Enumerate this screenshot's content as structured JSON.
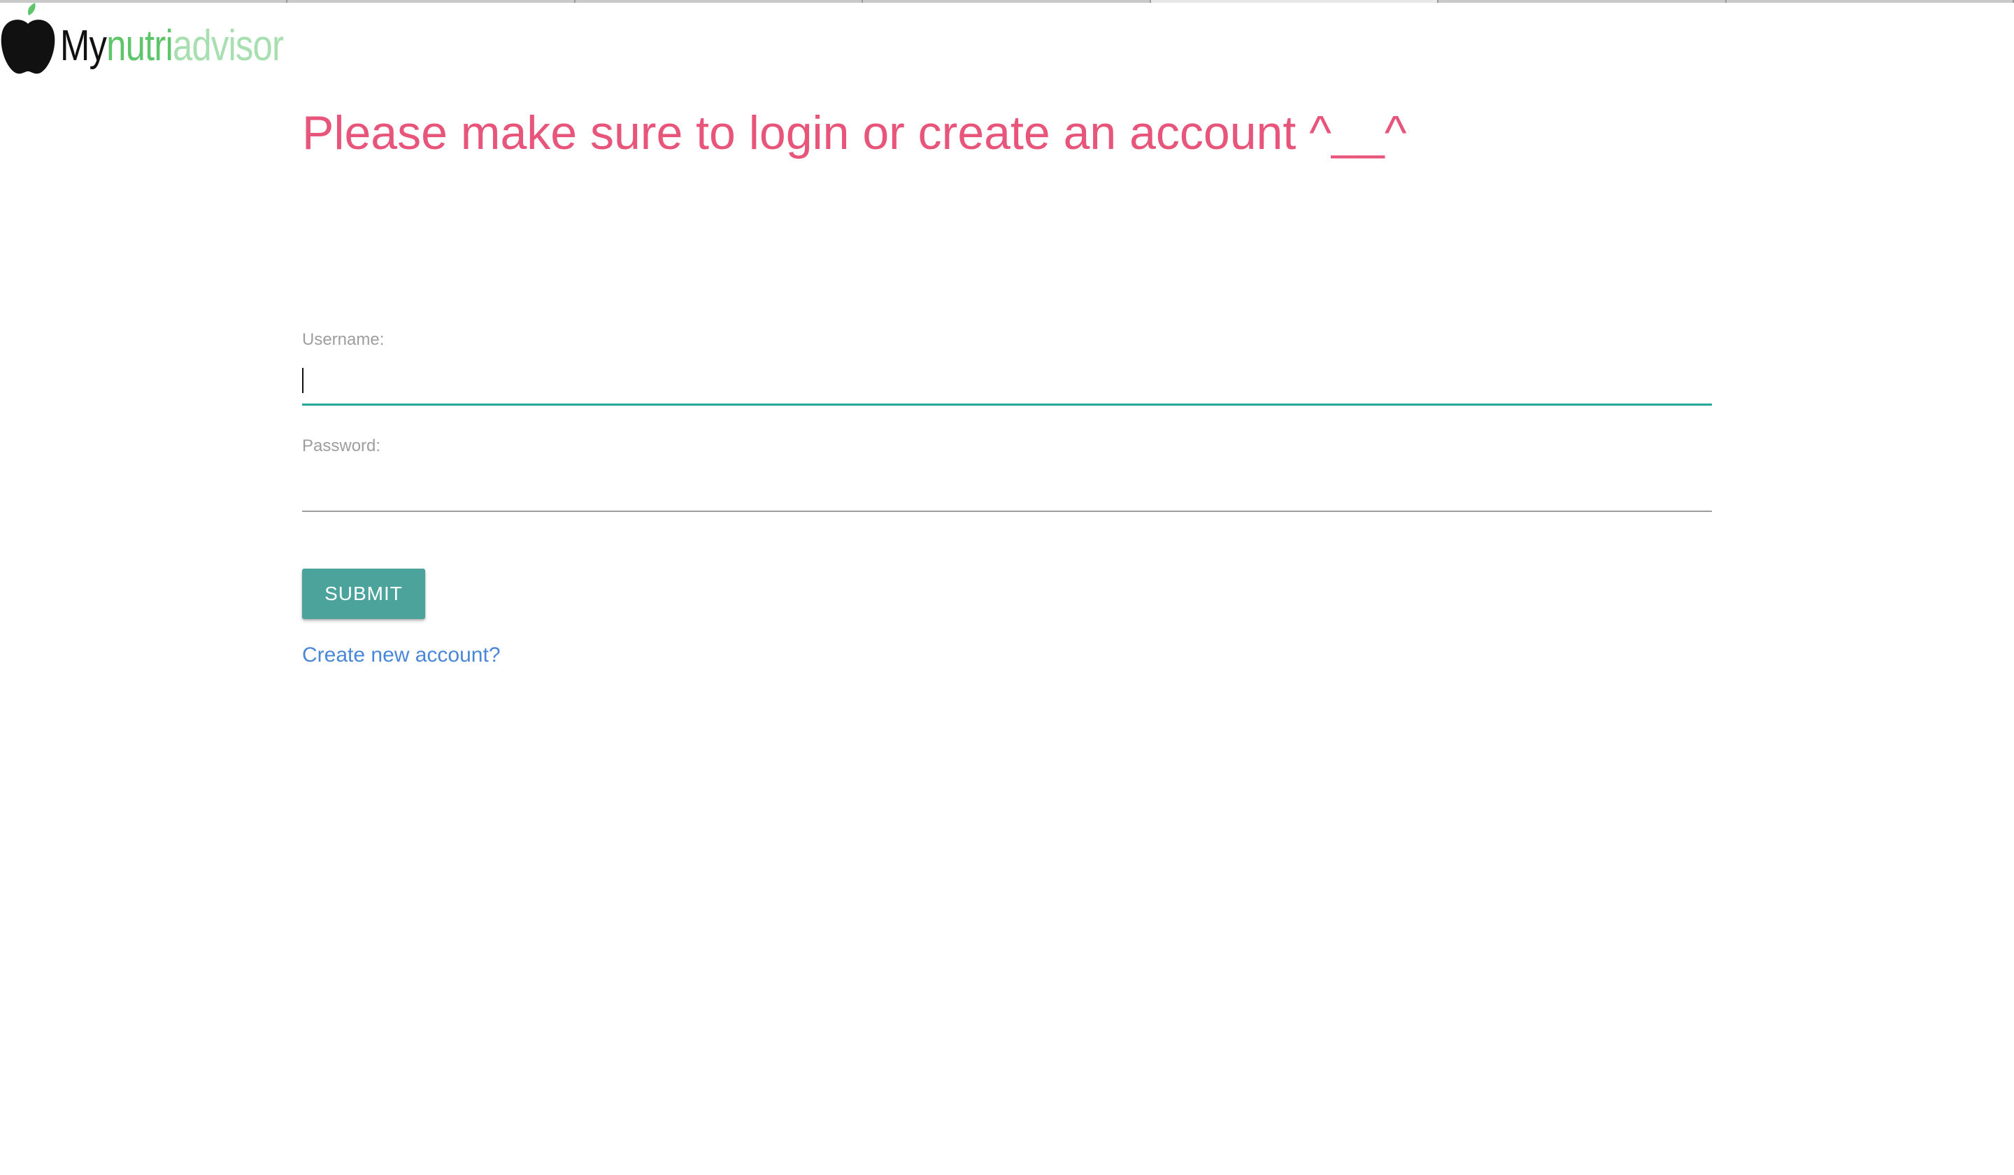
{
  "top_tabs": [
    "",
    "",
    "",
    "",
    "",
    "",
    ""
  ],
  "brand": {
    "part1": "My",
    "part2": "nutri",
    "part3": "advisor",
    "colors": {
      "my": "#111111",
      "nutri": "#5fc56b",
      "advisor": "#a8dfb0"
    }
  },
  "page": {
    "heading": "Please make sure to login or create an account ^__^",
    "heading_color": "#e8557a"
  },
  "form": {
    "username_label": "Username:",
    "username_value": "",
    "password_label": "Password:",
    "password_value": "",
    "submit_label": "SUBMIT",
    "submit_color": "#4ba39b",
    "focus_color": "#26a69a",
    "create_account_link": "Create new account?"
  }
}
